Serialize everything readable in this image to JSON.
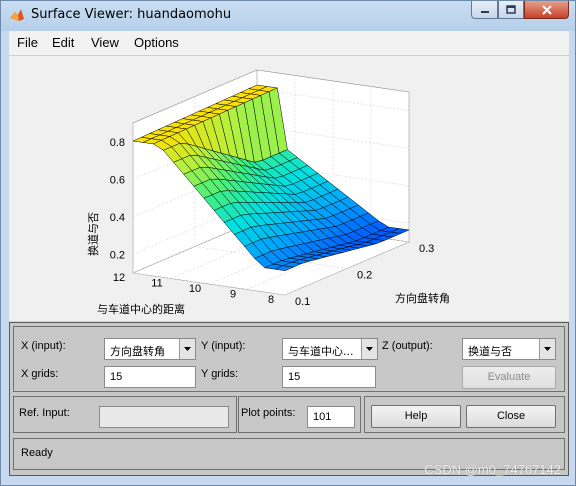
{
  "window": {
    "title": "Surface Viewer: huandaomohu"
  },
  "menu": [
    "File",
    "Edit",
    "View",
    "Options"
  ],
  "chart_data": {
    "type": "surface",
    "zlabel": "换道与否",
    "ylabel": "方向盘转角",
    "xlabel": "与车道中心的距离",
    "xlim": [
      8,
      12
    ],
    "ylim": [
      0.1,
      0.3
    ],
    "zlim": [
      0.1,
      0.9
    ],
    "x_ticks": [
      "8",
      "9",
      "10",
      "11",
      "12"
    ],
    "y_ticks": [
      "0.1",
      "0.2",
      "0.3"
    ],
    "z_ticks": [
      "0.2",
      "0.4",
      "0.6",
      "0.8"
    ],
    "grid": true,
    "colormap": [
      "#0050ff",
      "#00a0ff",
      "#00e0e0",
      "#40f080",
      "#b0f040",
      "#ffe000"
    ]
  },
  "controls": {
    "x_input_label": "X (input):",
    "x_input_value": "方向盘转角",
    "y_input_label": "Y (input):",
    "y_input_value": "与车道中心...",
    "z_output_label": "Z (output):",
    "z_output_value": "换道与否",
    "x_grids_label": "X grids:",
    "x_grids_value": "15",
    "y_grids_label": "Y grids:",
    "y_grids_value": "15",
    "evaluate_label": "Evaluate",
    "ref_input_label": "Ref. Input:",
    "ref_input_value": "",
    "plot_points_label": "Plot points:",
    "plot_points_value": "101",
    "help_label": "Help",
    "close_label": "Close",
    "status": "Ready"
  },
  "watermark": "CSDN @m0_74767142"
}
